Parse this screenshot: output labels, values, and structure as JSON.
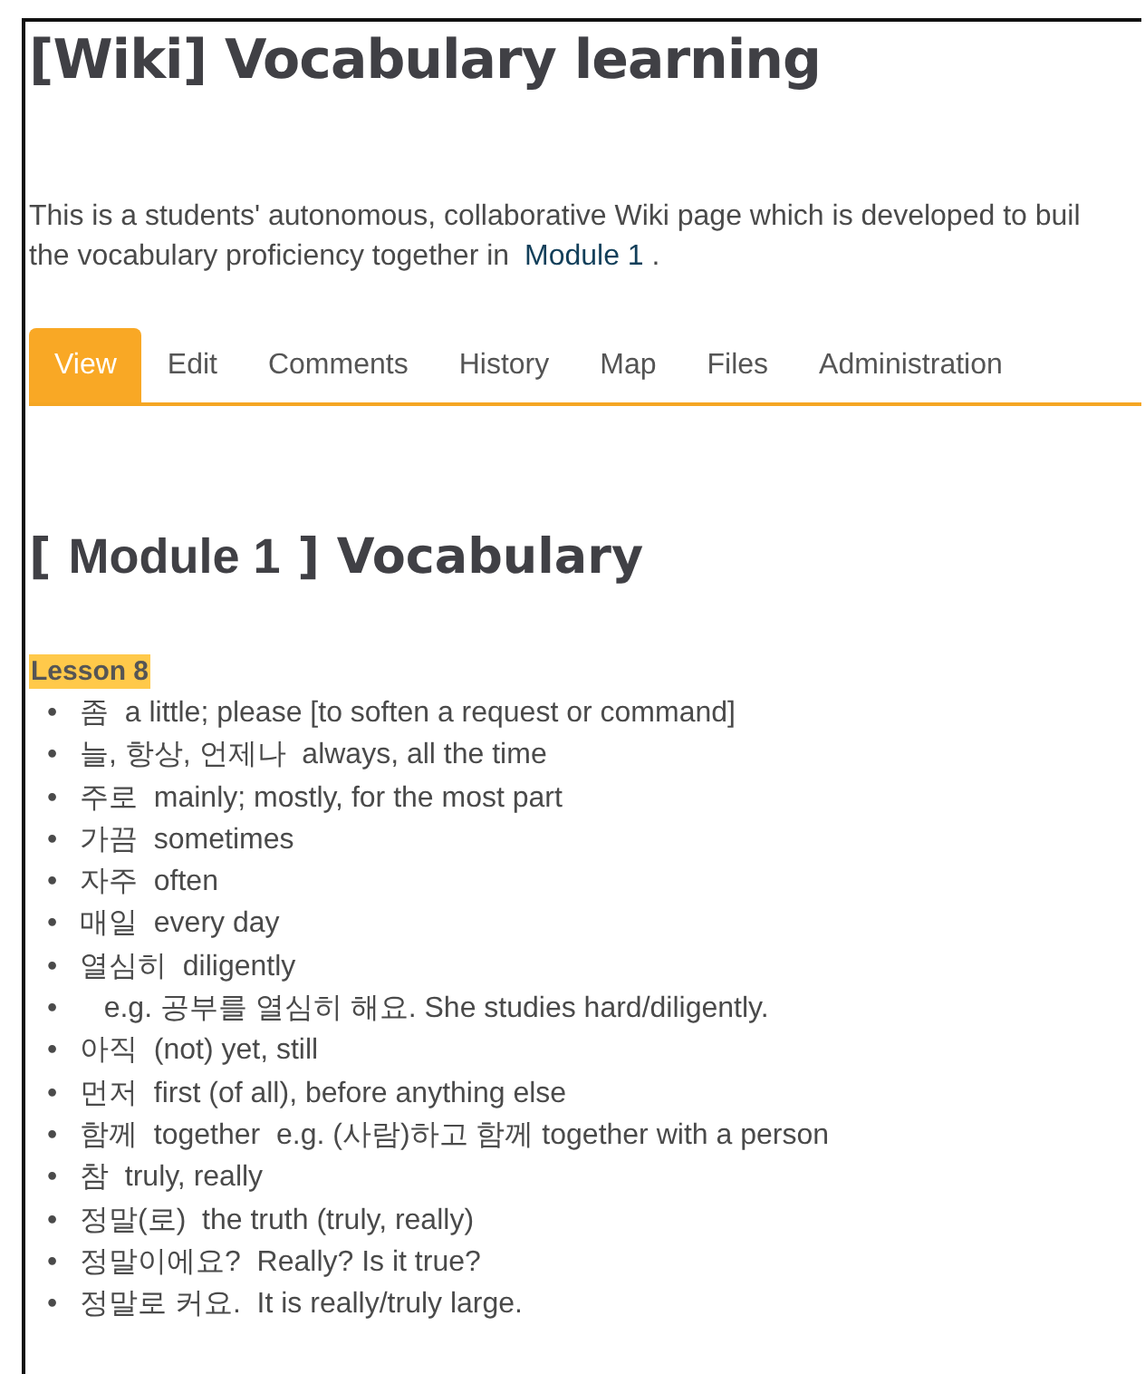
{
  "page": {
    "title": "[Wiki] Vocabulary learning",
    "description": {
      "line_1": "This is a students' autonomous, collaborative Wiki page which is developed to buil",
      "line_2": "the vocabulary proficiency together in",
      "link": "Module 1",
      "end": "."
    },
    "tabs": [
      {
        "label": "View",
        "selected": true
      },
      {
        "label": "Edit",
        "selected": false
      },
      {
        "label": "Comments",
        "selected": false
      },
      {
        "label": "History",
        "selected": false
      },
      {
        "label": "Map",
        "selected": false
      },
      {
        "label": "Files",
        "selected": false
      },
      {
        "label": "Administration",
        "selected": false
      }
    ],
    "heading": {
      "open": "[",
      "module": "Module 1",
      "close": "] Vocabulary"
    },
    "lesson": "Lesson 8",
    "bullet": "•",
    "items": [
      {
        "word": "좀",
        "meaning": "a little; please [to soften a request or command]"
      },
      {
        "word": "늘, 항상, 언제나",
        "meaning": "always, all the time"
      },
      {
        "word": "주로",
        "meaning": "mainly; mostly, for the most part"
      },
      {
        "word": "가끔",
        "meaning": "sometimes"
      },
      {
        "word": "자주",
        "meaning": "often"
      },
      {
        "word": "매일",
        "meaning": "every day"
      },
      {
        "word": "열심히",
        "meaning": "diligently"
      },
      {
        "meaning": "e.g. 공부를 열심히 해요. She studies hard/diligently."
      },
      {
        "word": "아직",
        "meaning": "(not) yet, still"
      },
      {
        "word": "먼저",
        "meaning": "first (of all), before anything else"
      },
      {
        "word": "함께",
        "meaning": "together  e.g. (사람)하고 함께 together with a person"
      },
      {
        "word": "참",
        "meaning": "truly, really"
      },
      {
        "word": "정말(로)",
        "meaning": "the truth (truly, really)"
      },
      {
        "word": "정말이에요?",
        "meaning": "Really? Is it true?"
      },
      {
        "word": "정말로 커요.",
        "meaning": "It is really/truly large."
      }
    ]
  }
}
